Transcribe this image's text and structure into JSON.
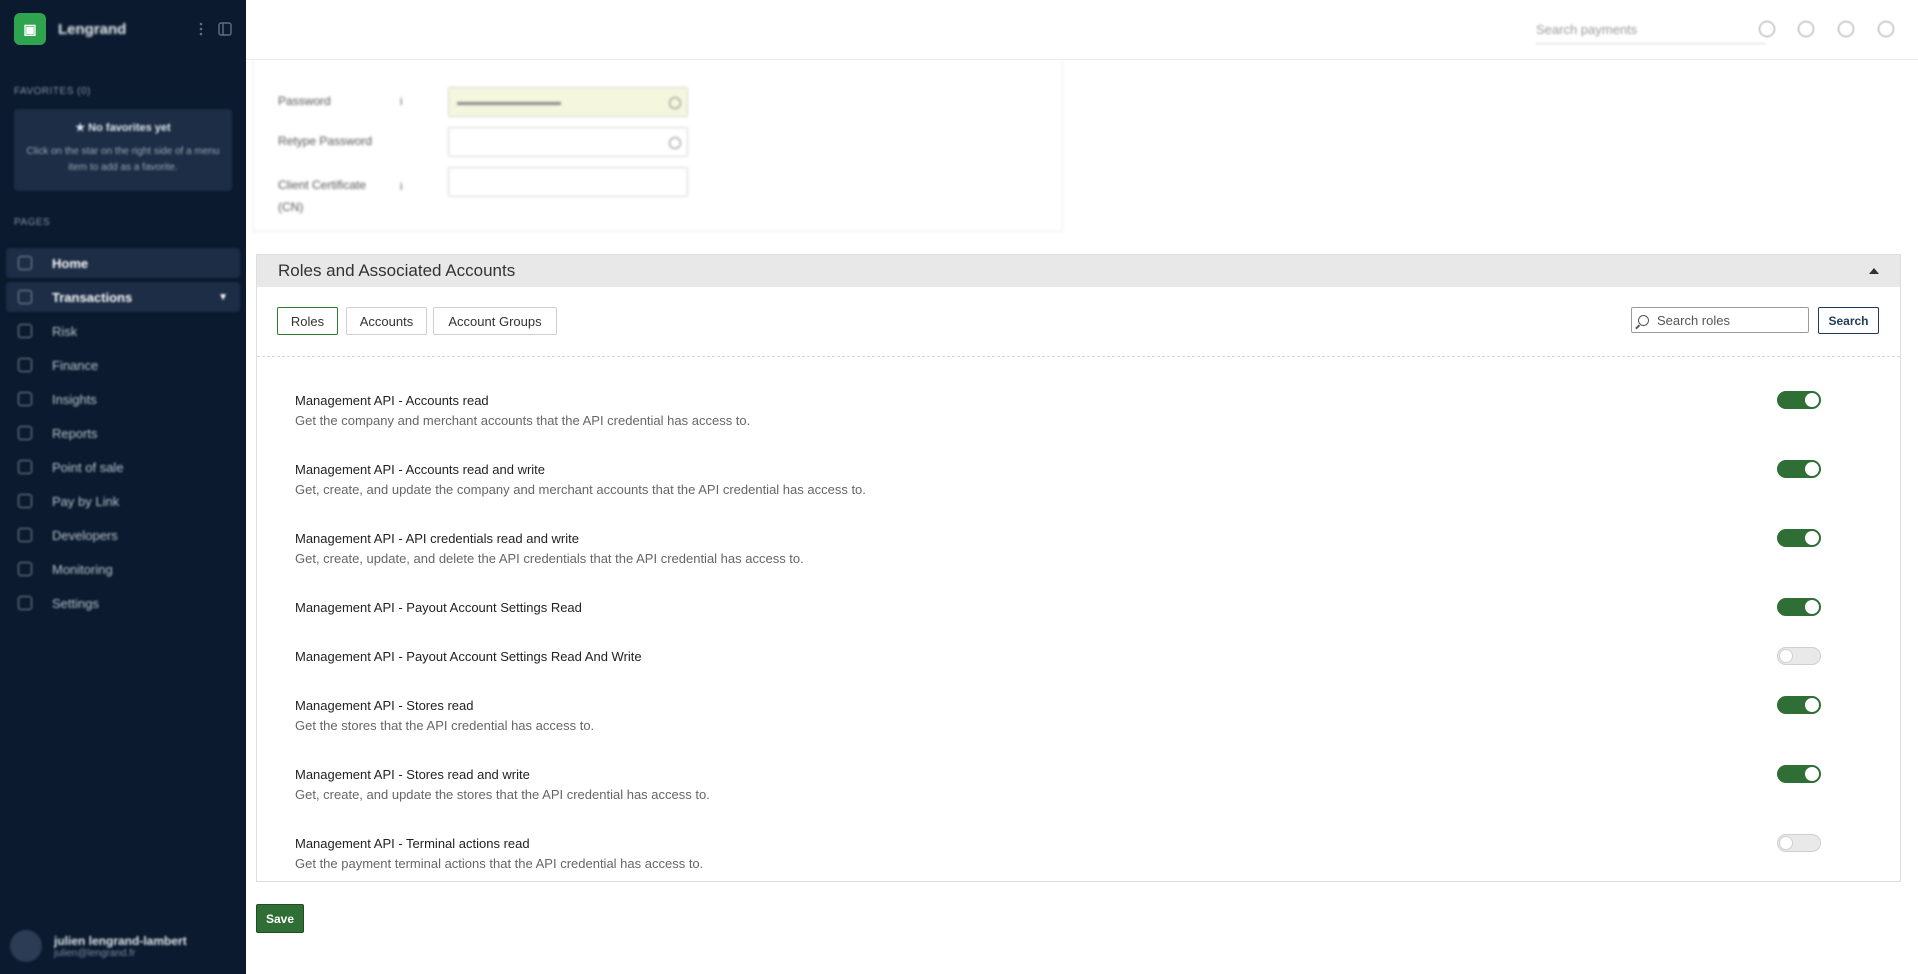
{
  "sidebar": {
    "brand": "Lengrand",
    "logo_glyph": "▣",
    "favorites_label": "FAVORITES (0)",
    "favorites_title": "★ No favorites yet",
    "favorites_text": "Click on the star on the right side of a menu item to add as a favorite.",
    "pages_label": "PAGES",
    "items": [
      {
        "label": "Home",
        "icon": "home-icon",
        "active": true
      },
      {
        "label": "Transactions",
        "icon": "transactions-icon",
        "active": true,
        "expandable": true
      },
      {
        "label": "Risk",
        "icon": "risk-icon"
      },
      {
        "label": "Finance",
        "icon": "finance-icon"
      },
      {
        "label": "Insights",
        "icon": "insights-icon"
      },
      {
        "label": "Reports",
        "icon": "reports-icon"
      },
      {
        "label": "Point of sale",
        "icon": "pos-icon"
      },
      {
        "label": "Pay by Link",
        "icon": "link-icon"
      },
      {
        "label": "Developers",
        "icon": "code-icon"
      },
      {
        "label": "Monitoring",
        "icon": "monitor-icon"
      },
      {
        "label": "Settings",
        "icon": "gear-icon"
      }
    ],
    "user": {
      "name": "julien lengrand-lambert",
      "email": "julien@lengrand.fr"
    }
  },
  "topbar": {
    "search_placeholder": "Search payments"
  },
  "credentials": {
    "password_label": "Password",
    "retype_label": "Retype Password",
    "cert_label": "Client Certificate (CN)",
    "info_mark": "i"
  },
  "roles_section": {
    "title": "Roles and Associated Accounts",
    "tabs": [
      "Roles",
      "Accounts",
      "Account Groups"
    ],
    "search_placeholder": "Search roles",
    "search_button": "Search",
    "roles": [
      {
        "name": "Management API - Accounts read",
        "desc": "Get the company and merchant accounts that the API credential has access to.",
        "enabled": true
      },
      {
        "name": "Management API - Accounts read and write",
        "desc": "Get, create, and update the company and merchant accounts that the API credential has access to.",
        "enabled": true
      },
      {
        "name": "Management API - API credentials read and write",
        "desc": "Get, create, update, and delete the API credentials that the API credential has access to.",
        "enabled": true
      },
      {
        "name": "Management API - Payout Account Settings Read",
        "desc": "",
        "enabled": true
      },
      {
        "name": "Management API - Payout Account Settings Read And Write",
        "desc": "",
        "enabled": false
      },
      {
        "name": "Management API - Stores read",
        "desc": "Get the stores that the API credential has access to.",
        "enabled": true
      },
      {
        "name": "Management API - Stores read and write",
        "desc": "Get, create, and update the stores that the API credential has access to.",
        "enabled": true
      },
      {
        "name": "Management API - Terminal actions read",
        "desc": "Get the payment terminal actions that the API credential has access to.",
        "enabled": false
      }
    ]
  },
  "footer": {
    "save_label": "Save"
  },
  "colors": {
    "sidebar_bg": "#0b1a2e",
    "accent_green": "#2f6e35",
    "toggle_off": "#e9e9e9"
  }
}
